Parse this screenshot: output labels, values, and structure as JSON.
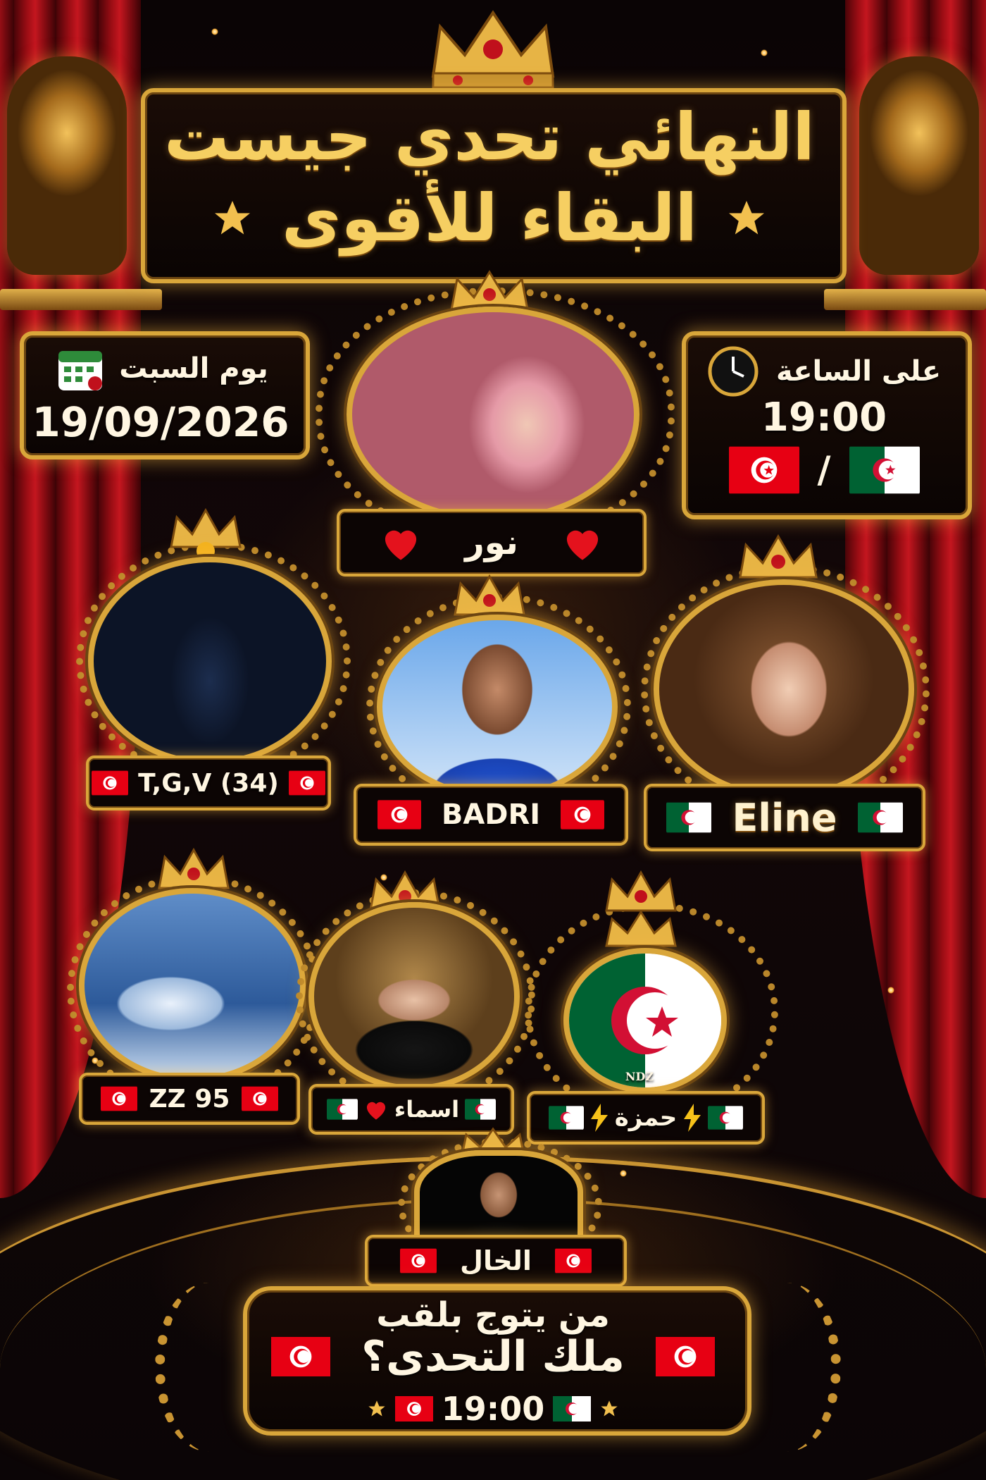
{
  "header": {
    "title_line1": "النهائي تحدي جيست",
    "title_line2": "البقاء للأقوى"
  },
  "date_box": {
    "day_label": "يوم السبت",
    "date": "19/09/2026"
  },
  "time_box": {
    "label": "على الساعة",
    "time": "19:00",
    "separator": "/"
  },
  "contestants": {
    "top": {
      "name": "نور"
    },
    "row1": [
      {
        "name": "T,G,V (34)"
      },
      {
        "name": "BADRI"
      },
      {
        "name": "Eline"
      }
    ],
    "row2": [
      {
        "name": "ZZ 95"
      },
      {
        "name": "اسماء"
      },
      {
        "name": "حمزة",
        "avatar_caption": "NDZ"
      }
    ],
    "bottom": {
      "name": "الخال"
    }
  },
  "footer": {
    "question_line1": "من يتوج بلقب",
    "question_line2": "ملك التحدى؟",
    "time": "19:00"
  },
  "colors": {
    "gold": "#d9a63a",
    "gold_text": "#f6cf62",
    "curtain_red": "#b0121b",
    "tunisia_red": "#e70013",
    "algeria_green": "#006233"
  },
  "icons": [
    "star-icon",
    "calendar-icon",
    "clock-icon",
    "heart-icon",
    "crown-icon",
    "lightning-icon",
    "tunisia-flag-icon",
    "algeria-flag-icon",
    "lion-statue"
  ]
}
